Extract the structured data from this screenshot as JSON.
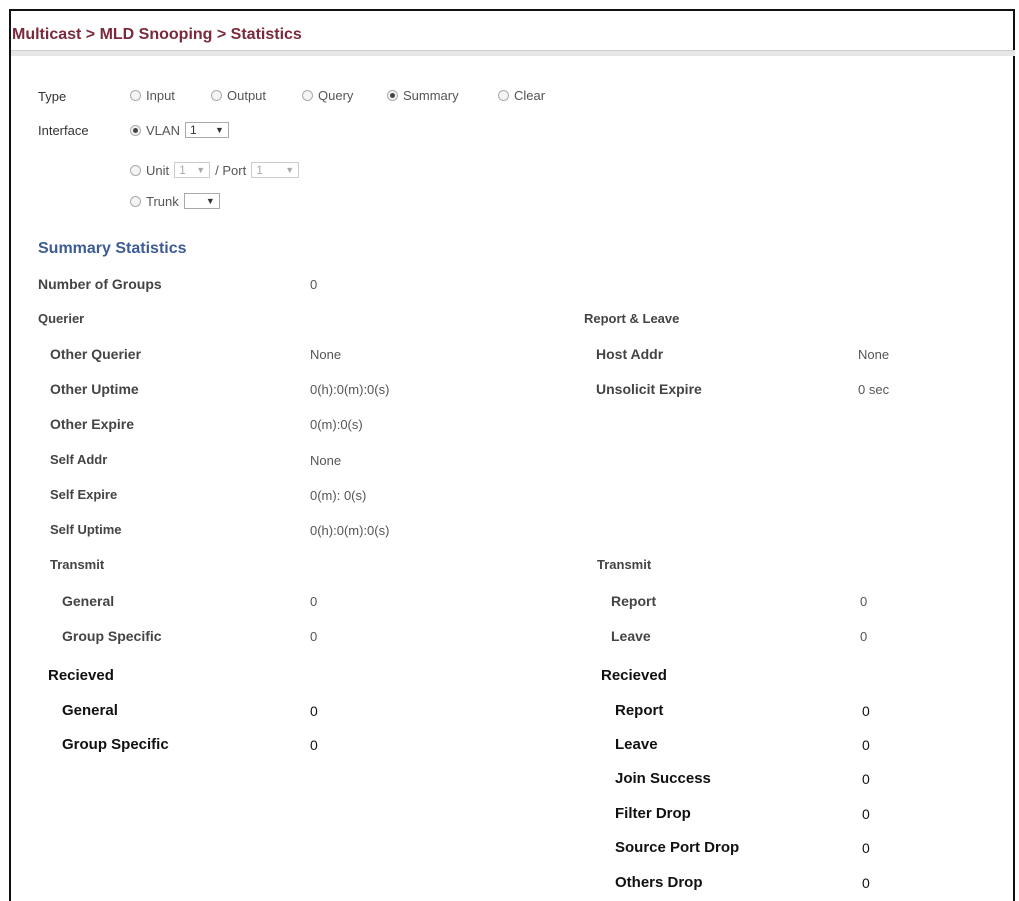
{
  "breadcrumb": "Multicast > MLD Snooping > Statistics",
  "form": {
    "type_label": "Type",
    "type_options": [
      {
        "label": "Input",
        "selected": false
      },
      {
        "label": "Output",
        "selected": false
      },
      {
        "label": "Query",
        "selected": false
      },
      {
        "label": "Summary",
        "selected": true
      },
      {
        "label": "Clear",
        "selected": false
      }
    ],
    "interface_label": "Interface",
    "vlan_label": "VLAN",
    "vlan_value": "1",
    "unit_label": "Unit",
    "unit_value": "1",
    "port_label": "/ Port",
    "port_value": "1",
    "trunk_label": "Trunk",
    "trunk_value": ""
  },
  "summary": {
    "title": "Summary Statistics",
    "groups_label": "Number of Groups",
    "groups_value": "0",
    "querier": {
      "heading": "Querier",
      "other_querier_label": "Other Querier",
      "other_querier_value": "None",
      "other_uptime_label": "Other Uptime",
      "other_uptime_value": "0(h):0(m):0(s)",
      "other_expire_label": "Other Expire",
      "other_expire_value": "0(m):0(s)",
      "self_addr_label": "Self Addr",
      "self_addr_value": "None",
      "self_expire_label": "Self Expire",
      "self_expire_value": "0(m): 0(s)",
      "self_uptime_label": "Self Uptime",
      "self_uptime_value": "0(h):0(m):0(s)",
      "transmit_heading": "Transmit",
      "tx_general_label": "General",
      "tx_general_value": "0",
      "tx_group_label": "Group Specific",
      "tx_group_value": "0",
      "received_heading": "Recieved",
      "rx_general_label": "General",
      "rx_general_value": "0",
      "rx_group_label": "Group Specific",
      "rx_group_value": "0"
    },
    "report_leave": {
      "heading": "Report & Leave",
      "host_addr_label": "Host Addr",
      "host_addr_value": "None",
      "unsolicit_label": "Unsolicit Expire",
      "unsolicit_value": "0 sec",
      "transmit_heading": "Transmit",
      "tx_report_label": "Report",
      "tx_report_value": "0",
      "tx_leave_label": "Leave",
      "tx_leave_value": "0",
      "received_heading": "Recieved",
      "rx_report_label": "Report",
      "rx_report_value": "0",
      "rx_leave_label": "Leave",
      "rx_leave_value": "0",
      "join_label": "Join Success",
      "join_value": "0",
      "filter_label": "Filter Drop",
      "filter_value": "0",
      "source_port_label": "Source Port Drop",
      "source_port_value": "0",
      "others_label": "Others Drop",
      "others_value": "0"
    }
  }
}
